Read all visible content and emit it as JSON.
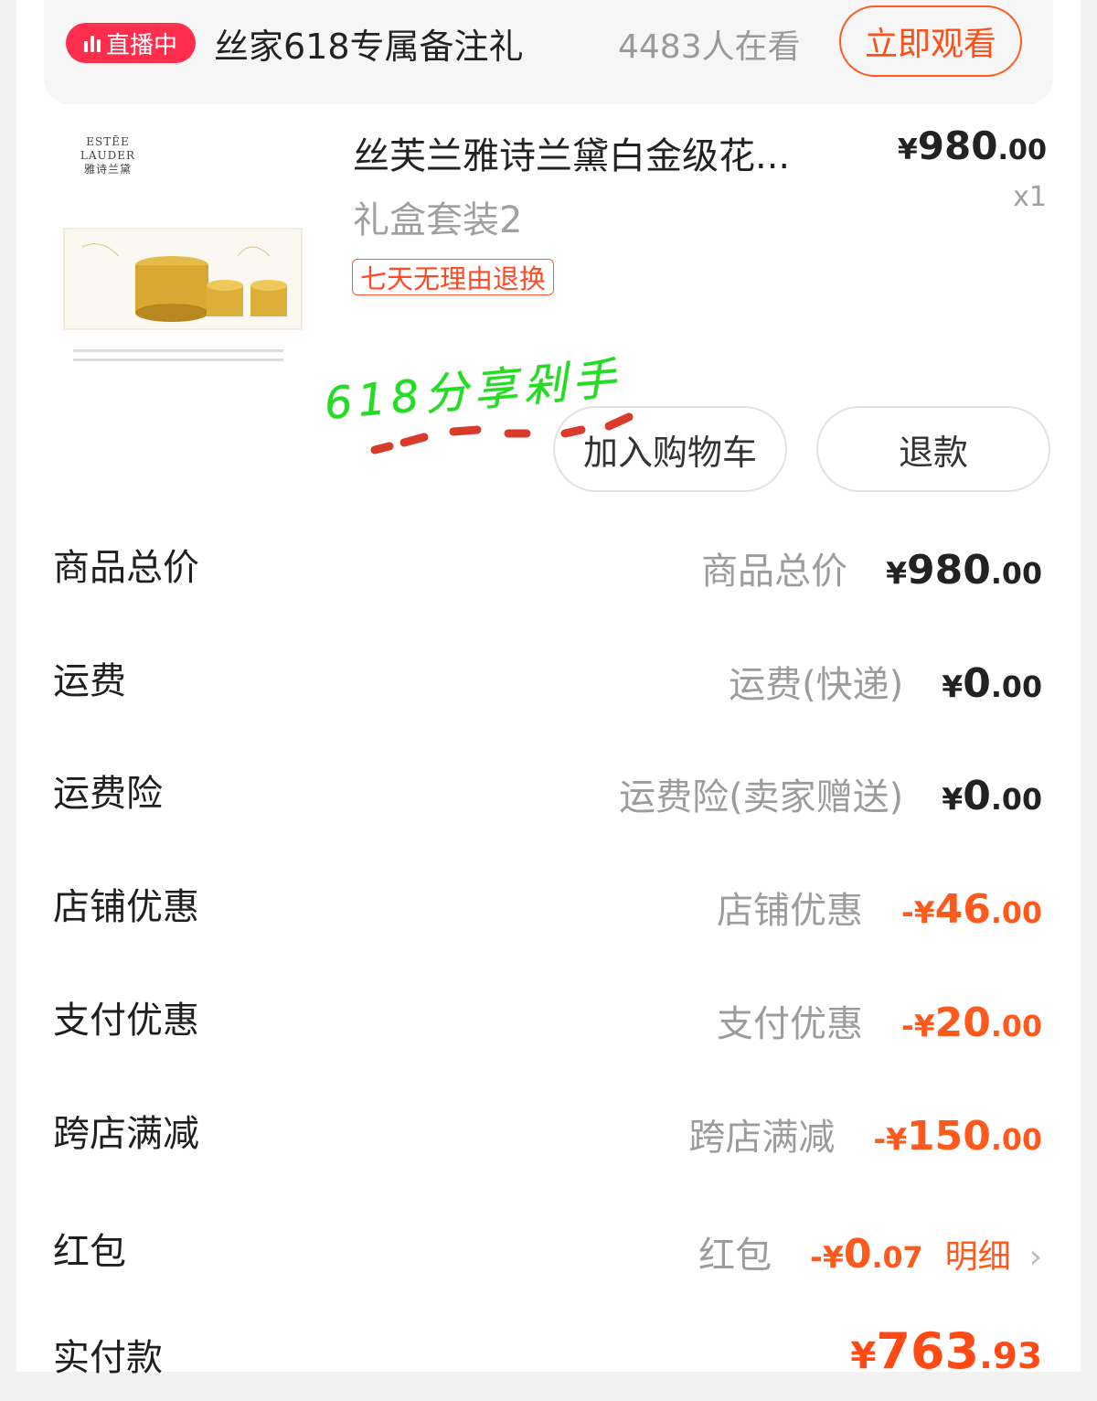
{
  "live": {
    "badge": "直播中",
    "title": "丝家618专属备注礼",
    "viewers": "4483人在看",
    "watch_button": "立即观看"
  },
  "product": {
    "brand": "ESTĒE LAUDER\n雅诗兰黛",
    "title": "丝芙兰雅诗兰黛白金级花...",
    "spec": "礼盒套装2",
    "return_tag": "七天无理由退换",
    "price_yen": "¥",
    "price_int": "980",
    "price_dec": ".00",
    "qty": "x1"
  },
  "annotation": "618分享剁手",
  "actions": {
    "add_to_cart": "加入购物车",
    "refund": "退款"
  },
  "rows": [
    {
      "label": "商品总价",
      "desc": "商品总价",
      "sign": "",
      "int": "980",
      "dec": ".00",
      "type": "normal"
    },
    {
      "label": "运费",
      "desc": "运费(快递)",
      "sign": "",
      "int": "0",
      "dec": ".00",
      "type": "normal"
    },
    {
      "label": "运费险",
      "desc": "运费险(卖家赠送)",
      "sign": "",
      "int": "0",
      "dec": ".00",
      "type": "normal"
    },
    {
      "label": "店铺优惠",
      "desc": "店铺优惠",
      "sign": "-",
      "int": "46",
      "dec": ".00",
      "type": "discount"
    },
    {
      "label": "支付优惠",
      "desc": "支付优惠",
      "sign": "-",
      "int": "20",
      "dec": ".00",
      "type": "discount"
    },
    {
      "label": "跨店满减",
      "desc": "跨店满减",
      "sign": "-",
      "int": "150",
      "dec": ".00",
      "type": "discount"
    },
    {
      "label": "红包",
      "desc": "红包",
      "sign": "-",
      "int": "0",
      "dec": ".07",
      "type": "discount",
      "link": "明细"
    }
  ],
  "total": {
    "label": "实付款",
    "int": "763",
    "dec": ".93"
  },
  "colors": {
    "accent": "#ff5a1e",
    "live": "#ff2e4d",
    "annotation": "#22dd22"
  }
}
